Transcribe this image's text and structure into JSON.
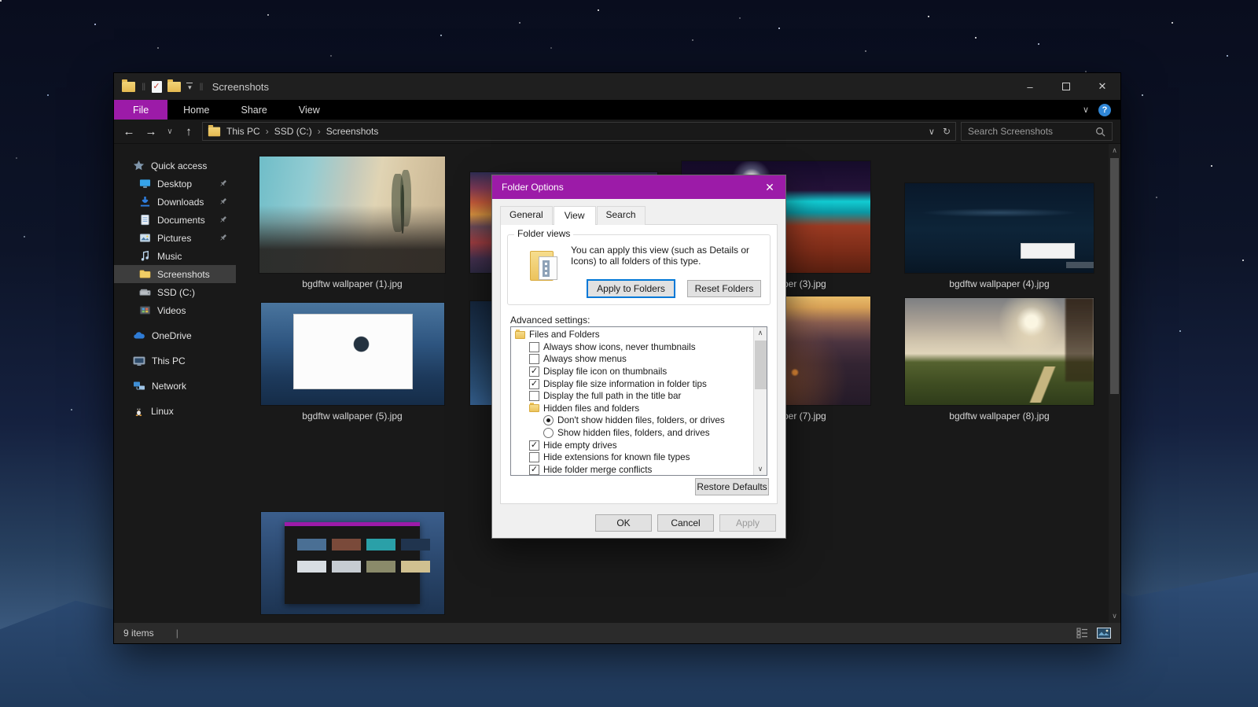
{
  "accent_color": "#9c1ba8",
  "window": {
    "title": "Screenshots",
    "ribbon_tabs": [
      {
        "label": "File",
        "active": true
      },
      {
        "label": "Home",
        "active": false
      },
      {
        "label": "Share",
        "active": false
      },
      {
        "label": "View",
        "active": false
      }
    ],
    "breadcrumb": [
      "This PC",
      "SSD (C:)",
      "Screenshots"
    ],
    "search_placeholder": "Search Screenshots",
    "status_items": "9 items"
  },
  "sidebar": {
    "items": [
      {
        "label": "Quick access",
        "icon": "star-icon",
        "level": 0,
        "pinned": false,
        "selected": false
      },
      {
        "label": "Desktop",
        "icon": "monitor-icon",
        "level": 1,
        "pinned": true,
        "selected": false
      },
      {
        "label": "Downloads",
        "icon": "download-icon",
        "level": 1,
        "pinned": true,
        "selected": false
      },
      {
        "label": "Documents",
        "icon": "document-icon",
        "level": 1,
        "pinned": true,
        "selected": false
      },
      {
        "label": "Pictures",
        "icon": "picture-icon",
        "level": 1,
        "pinned": true,
        "selected": false
      },
      {
        "label": "Music",
        "icon": "music-icon",
        "level": 1,
        "pinned": false,
        "selected": false
      },
      {
        "label": "Screenshots",
        "icon": "folder-icon",
        "level": 1,
        "pinned": false,
        "selected": true
      },
      {
        "label": "SSD (C:)",
        "icon": "drive-icon",
        "level": 1,
        "pinned": false,
        "selected": false
      },
      {
        "label": "Videos",
        "icon": "video-icon",
        "level": 1,
        "pinned": false,
        "selected": false
      },
      {
        "label": "OneDrive",
        "icon": "cloud-icon",
        "level": 0,
        "pinned": false,
        "selected": false
      },
      {
        "label": "This PC",
        "icon": "pc-icon",
        "level": 0,
        "pinned": false,
        "selected": false
      },
      {
        "label": "Network",
        "icon": "network-icon",
        "level": 0,
        "pinned": false,
        "selected": false
      },
      {
        "label": "Linux",
        "icon": "linux-icon",
        "level": 0,
        "pinned": false,
        "selected": false
      }
    ]
  },
  "files": [
    {
      "name": "bgdftw wallpaper (1).jpg",
      "thumbnail": "foggy road with lone tree"
    },
    {
      "name": "",
      "thumbnail": "red and blue sunset clouds, label hidden behind dialog"
    },
    {
      "name": "bgdftw wallpaper (3).jpg",
      "thumbnail": "teal glowing mountains over red rocks, partly behind dialog"
    },
    {
      "name": "bgdftw wallpaper (4).jpg",
      "thumbnail": "dark blue forest desktop screenshot with context menu"
    },
    {
      "name": "bgdftw wallpaper (5).jpg",
      "thumbnail": "white welcome window over blue mountains"
    },
    {
      "name": "",
      "thumbnail": "blue mountains, label hidden behind dialog"
    },
    {
      "name": "bgdftw wallpaper (7).jpg",
      "thumbnail": "city at dusk with orange lights, partly behind dialog"
    },
    {
      "name": "bgdftw wallpaper (8).jpg",
      "thumbnail": "stormy sky over green field with path"
    },
    {
      "name": "",
      "thumbnail": "file explorer screenshot over mountains, label cut off"
    }
  ],
  "dialog": {
    "title": "Folder Options",
    "tabs": [
      {
        "label": "General",
        "active": false
      },
      {
        "label": "View",
        "active": true
      },
      {
        "label": "Search",
        "active": false
      }
    ],
    "folder_views": {
      "group_label": "Folder views",
      "description": "You can apply this view (such as Details or Icons) to all folders of this type.",
      "apply_button": "Apply to Folders",
      "reset_button": "Reset Folders"
    },
    "advanced_label": "Advanced settings:",
    "advanced_items": [
      {
        "type": "folder",
        "indent": 0,
        "label": "Files and Folders"
      },
      {
        "type": "checkbox",
        "indent": 1,
        "checked": false,
        "label": "Always show icons, never thumbnails"
      },
      {
        "type": "checkbox",
        "indent": 1,
        "checked": false,
        "label": "Always show menus"
      },
      {
        "type": "checkbox",
        "indent": 1,
        "checked": true,
        "label": "Display file icon on thumbnails"
      },
      {
        "type": "checkbox",
        "indent": 1,
        "checked": true,
        "label": "Display file size information in folder tips"
      },
      {
        "type": "checkbox",
        "indent": 1,
        "checked": false,
        "label": "Display the full path in the title bar"
      },
      {
        "type": "folder",
        "indent": 1,
        "label": "Hidden files and folders"
      },
      {
        "type": "radio",
        "indent": 2,
        "checked": true,
        "label": "Don't show hidden files, folders, or drives"
      },
      {
        "type": "radio",
        "indent": 2,
        "checked": false,
        "label": "Show hidden files, folders, and drives"
      },
      {
        "type": "checkbox",
        "indent": 1,
        "checked": true,
        "label": "Hide empty drives"
      },
      {
        "type": "checkbox",
        "indent": 1,
        "checked": false,
        "label": "Hide extensions for known file types"
      },
      {
        "type": "checkbox",
        "indent": 1,
        "checked": true,
        "label": "Hide folder merge conflicts"
      }
    ],
    "restore_button": "Restore Defaults",
    "ok_button": "OK",
    "cancel_button": "Cancel",
    "apply_button": "Apply"
  }
}
